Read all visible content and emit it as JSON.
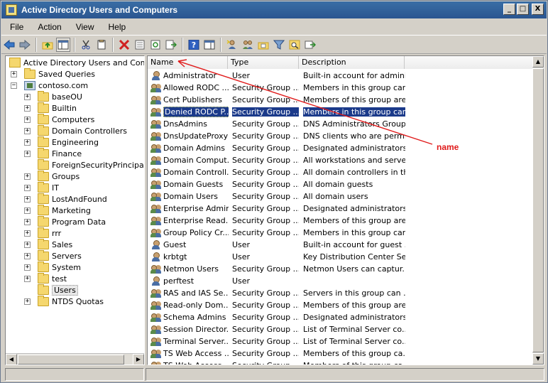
{
  "window": {
    "title": "Active Directory Users and Computers",
    "minimize": "_",
    "maximize": "□",
    "close": "X"
  },
  "menu": [
    "File",
    "Action",
    "View",
    "Help"
  ],
  "toolbar": {
    "icons": [
      "back-arrow-icon",
      "forward-arrow-icon",
      "up-folder-icon",
      "show-hide-console-tree-icon",
      "cut-icon",
      "copy-icon",
      "delete-icon",
      "properties-icon",
      "refresh-icon",
      "export-list-icon",
      "help-icon",
      "show-action-pane-icon",
      "new-user-icon",
      "new-group-icon",
      "new-ou-icon",
      "filter-icon",
      "find-icon",
      "add-to-group-icon"
    ]
  },
  "tree": {
    "root": "Active Directory Users and Comput",
    "saved_queries": "Saved Queries",
    "domain": "contoso.com",
    "containers": [
      {
        "label": "baseOU",
        "expandable": true
      },
      {
        "label": "Builtin",
        "expandable": true
      },
      {
        "label": "Computers",
        "expandable": true
      },
      {
        "label": "Domain Controllers",
        "expandable": true
      },
      {
        "label": "Engineering",
        "expandable": true
      },
      {
        "label": "Finance",
        "expandable": true
      },
      {
        "label": "ForeignSecurityPrincipals",
        "expandable": false
      },
      {
        "label": "Groups",
        "expandable": true
      },
      {
        "label": "IT",
        "expandable": true
      },
      {
        "label": "LostAndFound",
        "expandable": true
      },
      {
        "label": "Marketing",
        "expandable": true
      },
      {
        "label": "Program Data",
        "expandable": true
      },
      {
        "label": "rrr",
        "expandable": true
      },
      {
        "label": "Sales",
        "expandable": true
      },
      {
        "label": "Servers",
        "expandable": true
      },
      {
        "label": "System",
        "expandable": true
      },
      {
        "label": "test",
        "expandable": true
      },
      {
        "label": "Users",
        "expandable": false,
        "selected": true
      },
      {
        "label": "NTDS Quotas",
        "expandable": true
      }
    ]
  },
  "list": {
    "columns": [
      "Name",
      "Type",
      "Description"
    ],
    "rows": [
      {
        "icon": "user",
        "name": "Administrator",
        "type": "User",
        "desc": "Built-in account for admini..."
      },
      {
        "icon": "group",
        "name": "Allowed RODC ...",
        "type": "Security Group ...",
        "desc": "Members in this group can..."
      },
      {
        "icon": "group",
        "name": "Cert Publishers",
        "type": "Security Group ...",
        "desc": "Members of this group are..."
      },
      {
        "icon": "group",
        "name": "Denied RODC P...",
        "type": "Security Group ...",
        "desc": "Members in this group can...",
        "selected": true
      },
      {
        "icon": "group",
        "name": "DnsAdmins",
        "type": "Security Group ...",
        "desc": "DNS Administrators Group"
      },
      {
        "icon": "group",
        "name": "DnsUpdateProxy",
        "type": "Security Group ...",
        "desc": "DNS clients who are permi..."
      },
      {
        "icon": "group",
        "name": "Domain Admins",
        "type": "Security Group ...",
        "desc": "Designated administrators..."
      },
      {
        "icon": "group",
        "name": "Domain Comput...",
        "type": "Security Group ...",
        "desc": "All workstations and serve..."
      },
      {
        "icon": "group",
        "name": "Domain Controll...",
        "type": "Security Group ...",
        "desc": "All domain controllers in th..."
      },
      {
        "icon": "group",
        "name": "Domain Guests",
        "type": "Security Group ...",
        "desc": "All domain guests"
      },
      {
        "icon": "group",
        "name": "Domain Users",
        "type": "Security Group ...",
        "desc": "All domain users"
      },
      {
        "icon": "group",
        "name": "Enterprise Admins",
        "type": "Security Group ...",
        "desc": "Designated administrators..."
      },
      {
        "icon": "group",
        "name": "Enterprise Read...",
        "type": "Security Group ...",
        "desc": "Members of this group are..."
      },
      {
        "icon": "group",
        "name": "Group Policy Cr...",
        "type": "Security Group ...",
        "desc": "Members in this group can..."
      },
      {
        "icon": "user",
        "name": "Guest",
        "type": "User",
        "desc": "Built-in account for guest ..."
      },
      {
        "icon": "user",
        "name": "krbtgt",
        "type": "User",
        "desc": "Key Distribution Center Se..."
      },
      {
        "icon": "group",
        "name": "Netmon Users",
        "type": "Security Group ...",
        "desc": "Netmon Users can captur..."
      },
      {
        "icon": "user",
        "name": "perftest",
        "type": "User",
        "desc": ""
      },
      {
        "icon": "group",
        "name": "RAS and IAS Se...",
        "type": "Security Group ...",
        "desc": "Servers in this group can ..."
      },
      {
        "icon": "group",
        "name": "Read-only Dom...",
        "type": "Security Group ...",
        "desc": "Members of this group are..."
      },
      {
        "icon": "group",
        "name": "Schema Admins",
        "type": "Security Group ...",
        "desc": "Designated administrators..."
      },
      {
        "icon": "group",
        "name": "Session Director...",
        "type": "Security Group ...",
        "desc": "List of Terminal Server co..."
      },
      {
        "icon": "group",
        "name": "Terminal Server...",
        "type": "Security Group ...",
        "desc": "List of Terminal Server co..."
      },
      {
        "icon": "group",
        "name": "TS Web Access ...",
        "type": "Security Group ...",
        "desc": "Members of this group ca..."
      },
      {
        "icon": "group",
        "name": "TS Web Access ...",
        "type": "Security Group ...",
        "desc": "Members of this group ca..."
      }
    ]
  },
  "annotation": {
    "label": "name",
    "color": "#e01a1a"
  }
}
